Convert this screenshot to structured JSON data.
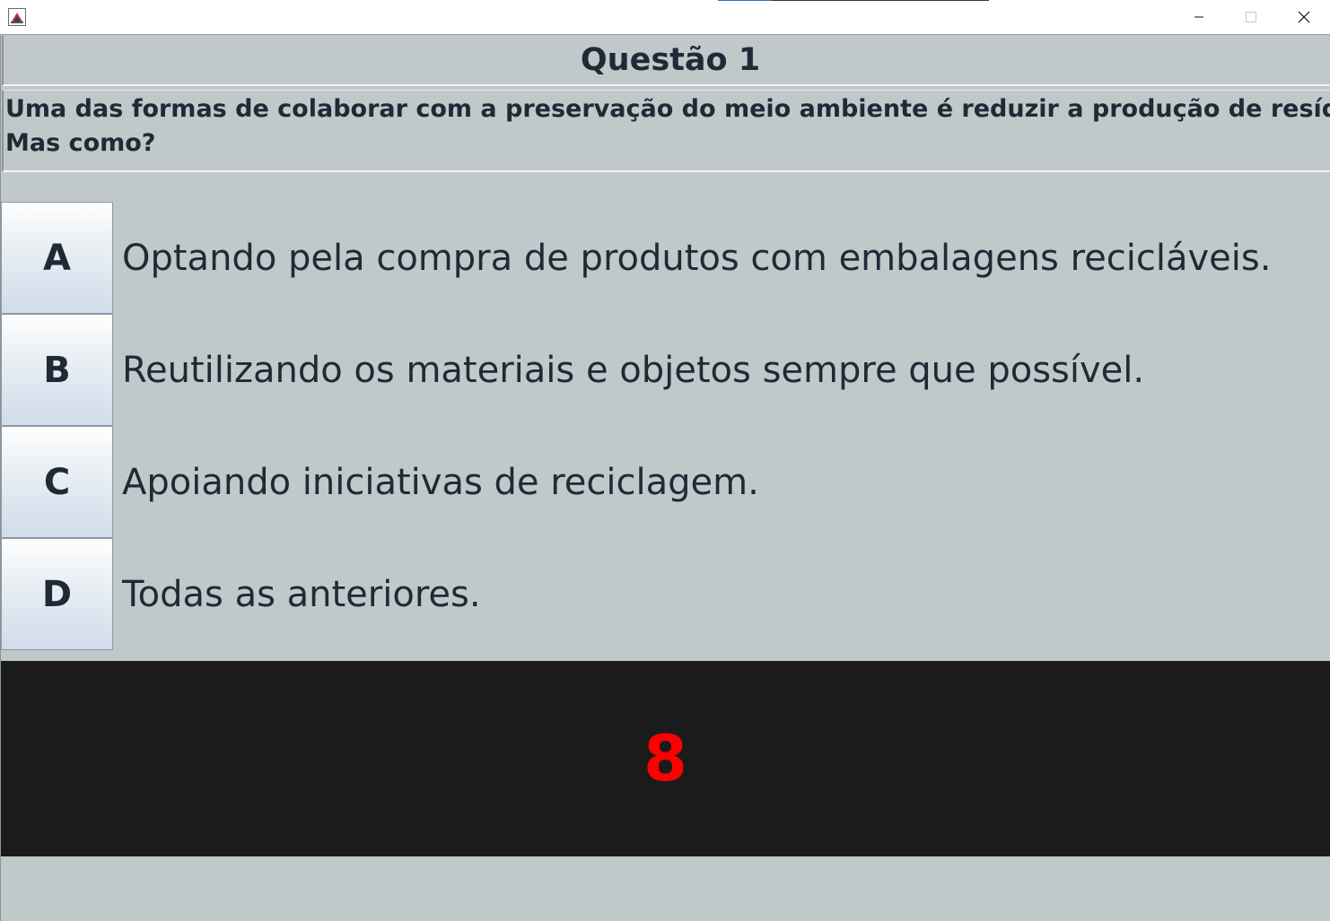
{
  "window": {
    "icon": "java-app-icon",
    "controls": {
      "minimize_icon": "minimize-icon",
      "maximize_icon": "maximize-icon",
      "close_icon": "close-icon"
    }
  },
  "question": {
    "title": "Questão 1",
    "text": "Uma das formas de colaborar com a preservação do meio ambiente é reduzir a produção de resíduos\nMas como?"
  },
  "options": [
    {
      "letter": "A",
      "text": "Optando pela compra de produtos com embalagens recicláveis."
    },
    {
      "letter": "B",
      "text": "Reutilizando os materiais e objetos sempre que possível."
    },
    {
      "letter": "C",
      "text": "Apoiando iniciativas de reciclagem."
    },
    {
      "letter": "D",
      "text": "Todas as anteriores."
    }
  ],
  "timer": {
    "value": "8",
    "color": "#ff0000",
    "background": "#1b1b1b"
  },
  "colors": {
    "panel_background": "#c0c8ca",
    "text": "#1f2a36"
  }
}
